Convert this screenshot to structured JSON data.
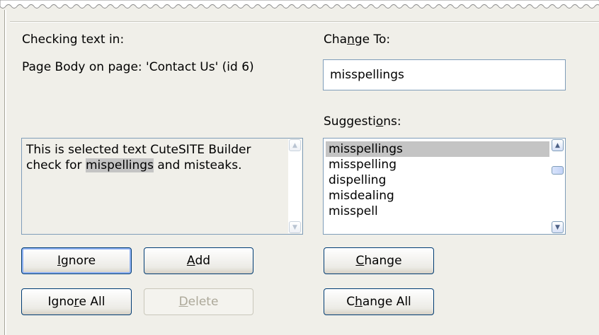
{
  "checking": {
    "label": "Checking text in:",
    "location": "Page Body on page: 'Contact Us' (id 6)"
  },
  "text_area": {
    "before": "This is selected text CuteSITE Builder check for ",
    "highlight": "mispellings",
    "after": " and misteaks."
  },
  "change_to": {
    "label_pre": "Cha",
    "label_accel": "n",
    "label_post": "ge To:",
    "value": "misspellings"
  },
  "suggestions": {
    "label_pre": "Suggesti",
    "label_accel": "o",
    "label_post": "ns:",
    "items": [
      "misspellings",
      "misspelling",
      "dispelling",
      "misdealing",
      "misspell"
    ],
    "selected_index": 0
  },
  "buttons": {
    "ignore": {
      "pre": "",
      "accel": "I",
      "post": "gnore"
    },
    "add": {
      "pre": "",
      "accel": "A",
      "post": "dd"
    },
    "ignore_all": {
      "pre": "Igno",
      "accel": "r",
      "post": "e All"
    },
    "delete": {
      "pre": "",
      "accel": "D",
      "post": "elete"
    },
    "change": {
      "pre": "",
      "accel": "C",
      "post": "hange"
    },
    "change_all": {
      "pre": "C",
      "accel": "h",
      "post": "ange All"
    }
  },
  "icons": {
    "scroll_up": "scroll-up-arrow-icon",
    "scroll_down": "scroll-down-arrow-icon"
  },
  "colors": {
    "dialog_bg": "#f0efe9",
    "field_border": "#7f9db9",
    "button_border": "#003c74",
    "selection": "#c4c4c4",
    "disabled_text": "#aca899"
  }
}
